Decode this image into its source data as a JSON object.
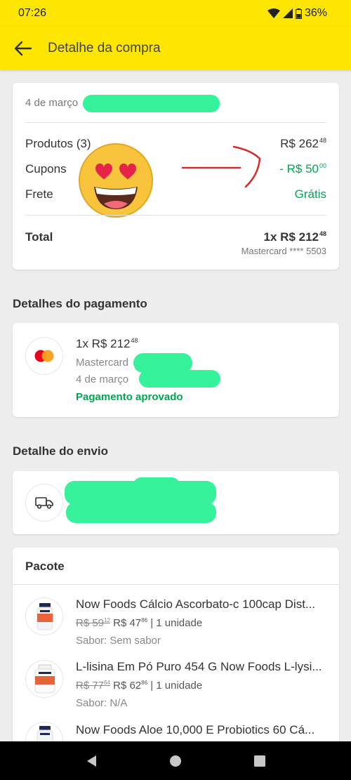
{
  "status": {
    "time": "07:26",
    "battery": "36%"
  },
  "appbar": {
    "title": "Detalhe da compra"
  },
  "summary": {
    "date": "4 de março",
    "products_label": "Produtos (3)",
    "products_int": "R$ 262",
    "products_dec": "48",
    "coupons_label": "Cupons",
    "coupons_int": "- R$ 50",
    "coupons_dec": "00",
    "shipping_label": "Frete",
    "shipping_value": "Grátis",
    "total_label": "Total",
    "total_int": "1x R$ 212",
    "total_dec": "48",
    "card_info": "Mastercard **** 5503"
  },
  "payment": {
    "section_title": "Detalhes do pagamento",
    "amount_int": "1x R$ 212",
    "amount_dec": "48",
    "card": "Mastercard",
    "date": "4 de março",
    "status": "Pagamento aprovado"
  },
  "shipping": {
    "section_title": "Detalhe do envio"
  },
  "package": {
    "title": "Pacote",
    "items": [
      {
        "title": "Now Foods Cálcio Ascorbato-c 100cap Dist...",
        "old_int": "R$ 59",
        "old_dec": "12",
        "new_int": "R$ 47",
        "new_dec": "86",
        "qty": "| 1 unidade",
        "flavor": "Sabor: Sem sabor"
      },
      {
        "title": "L-lisina Em Pó Puro 454 G Now Foods L-lysi...",
        "old_int": "R$ 77",
        "old_dec": "64",
        "new_int": "R$ 62",
        "new_dec": "86",
        "qty": "| 1 unidade",
        "flavor": "Sabor: N/A"
      },
      {
        "title": "Now Foods Aloe 10,000 E Probiotics 60 Cá..."
      }
    ]
  },
  "colors": {
    "brand_yellow": "#fee600",
    "success_green": "#00a650",
    "redaction": "#35f29a"
  }
}
